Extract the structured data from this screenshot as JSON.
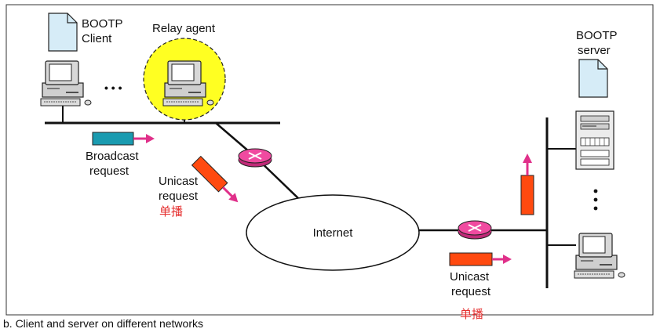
{
  "labels": {
    "bootp_client": [
      "BOOTP",
      "Client"
    ],
    "relay_agent": "Relay agent",
    "bootp_server": [
      "BOOTP",
      "server"
    ],
    "broadcast_request": [
      "Broadcast",
      "request"
    ],
    "unicast_request_left": [
      "Unicast",
      "request"
    ],
    "unicast_cn_left": "单播",
    "internet": "Internet",
    "unicast_request_right": [
      "Unicast",
      "request"
    ],
    "unicast_cn_right": "单播",
    "ellipsis_left": "• • •",
    "caption": "b. Client and server on different networks"
  },
  "colors": {
    "relay_highlight": "#ffff22",
    "broadcast_packet": "#1a9bb0",
    "unicast_packet": "#ff4a10",
    "arrow": "#e0308a",
    "router": "#f04aa0",
    "document": "#d6ecf7"
  }
}
